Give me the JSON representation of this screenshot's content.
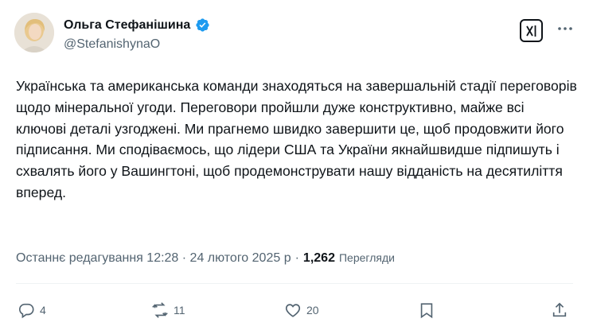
{
  "author": {
    "name": "Ольга Стефанішина",
    "handle": "@StefanishynaO",
    "verified": true
  },
  "tweet": {
    "text": "Українська та американська команди знаходяться на завершальній стадії переговорів щодо мінеральної угоди. Переговори пройшли дуже конструктивно, майже всі ключові деталі узгоджені. Ми прагнемо швидко завершити це, щоб продовжити його підписання. Ми сподіваємось, що лідери США та України якнайшвидше підпишуть і схвалять його у Вашингтоні, щоб продемонструвати нашу відданість на десятиліття вперед."
  },
  "meta": {
    "edited": "Останнє редагування 12:28 · 24 лютого 2025 р",
    "separator": "·",
    "views_count": "1,262",
    "views_label": "Перегляди"
  },
  "actions": {
    "replies": "4",
    "reposts": "11",
    "likes": "20"
  },
  "icons": {
    "grok": "grok-icon",
    "more": "more-icon",
    "reply": "reply-icon",
    "repost": "repost-icon",
    "like": "like-icon",
    "bookmark": "bookmark-icon",
    "share": "share-icon"
  },
  "colors": {
    "verified": "#1d9bf0",
    "text": "#0f1419",
    "secondary": "#536471"
  }
}
